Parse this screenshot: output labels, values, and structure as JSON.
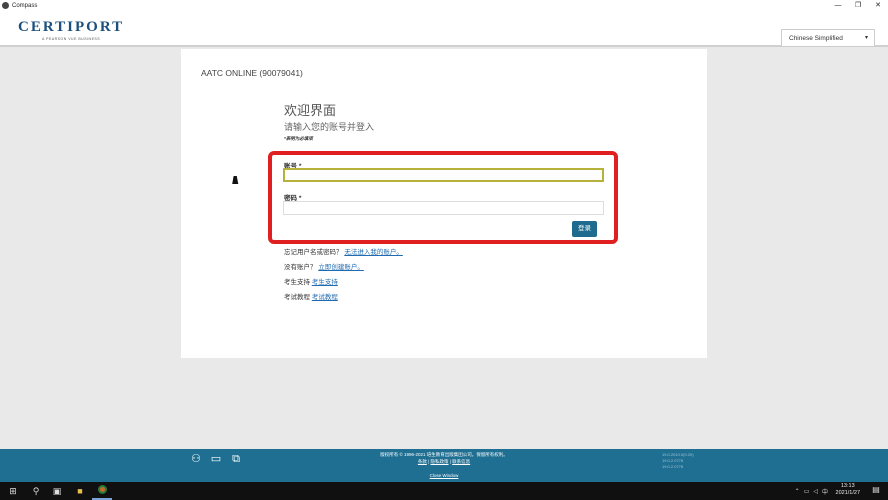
{
  "window": {
    "title": "Compass",
    "controls": {
      "minimize": "—",
      "restore": "❐",
      "close": "✕"
    }
  },
  "header": {
    "logo_text": "CERTIPORT",
    "logo_tagline": "A PEARSON VUE BUSINESS",
    "language": "Chinese Simplified"
  },
  "main": {
    "center_name": "AATC ONLINE (90079041)",
    "welcome": "欢迎界面",
    "subtitle": "请输入您的账号并登入",
    "required_note": "*表明为必填项",
    "form": {
      "username_label": "账号",
      "password_label": "密码",
      "required_marker": "*",
      "username_value": "",
      "password_value": "",
      "login_button": "登录"
    },
    "links": [
      {
        "prefix": "忘记用户名或密码？",
        "link": "无法进入我的账户。"
      },
      {
        "prefix": "没有账户？",
        "link": "立即创建账户。"
      },
      {
        "prefix": "考生支持",
        "link": "考生支持"
      },
      {
        "prefix": "考试教程",
        "link": "考试教程"
      }
    ]
  },
  "footer": {
    "copyright": "版权所有 © 1996-2021 培生教育出版集团公司。保留所有权利。",
    "links": [
      "条款",
      "隐私政策",
      "联系信息"
    ],
    "close_window": "Close Window",
    "version_lines": [
      "19.0.2010.0(0.20)",
      "19.0.2.0778",
      "19.0.2.0778"
    ],
    "icons": [
      "proctor-icon",
      "monitor-icon",
      "display-icon"
    ]
  },
  "taskbar": {
    "time": "13:13",
    "date": "2021/1/27",
    "ime": "中",
    "icons": [
      "windows-start-icon",
      "search-icon",
      "task-view-icon",
      "file-explorer-icon",
      "compass-app-icon"
    ]
  },
  "colors": {
    "brand_blue": "#1c4f7c",
    "footer_bg": "#1f6f92",
    "highlight_red": "#e02020",
    "focus_border": "#b5b13a",
    "button_bg": "#1f6a8f"
  }
}
